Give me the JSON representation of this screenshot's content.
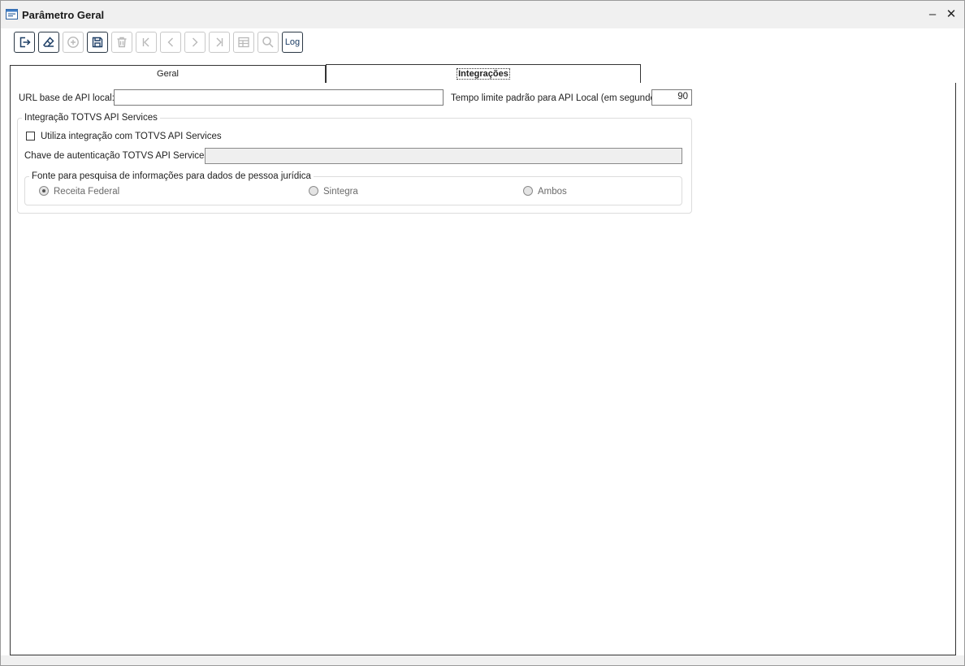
{
  "window": {
    "title": "Parâmetro Geral",
    "minimize_glyph": "–",
    "close_glyph": "✕"
  },
  "toolbar": {
    "buttons": [
      {
        "icon": "exit-icon",
        "enabled": true
      },
      {
        "icon": "eraser-icon",
        "enabled": true
      },
      {
        "icon": "add-circle-icon",
        "enabled": false
      },
      {
        "icon": "save-icon",
        "enabled": true
      },
      {
        "icon": "trash-icon",
        "enabled": false
      },
      {
        "icon": "first-record-icon",
        "enabled": false
      },
      {
        "icon": "previous-record-icon",
        "enabled": false
      },
      {
        "icon": "next-record-icon",
        "enabled": false
      },
      {
        "icon": "last-record-icon",
        "enabled": false
      },
      {
        "icon": "table-icon",
        "enabled": false
      },
      {
        "icon": "search-icon",
        "enabled": false
      }
    ],
    "log_label": "Log"
  },
  "tabs": [
    {
      "label": "Geral",
      "active": false
    },
    {
      "label": "Integrações",
      "active": true
    }
  ],
  "form": {
    "url_label": "URL base de API local:",
    "url_value": "",
    "timeout_label": "Tempo limite padrão para API Local (em segundos):",
    "timeout_value": "90",
    "group_title": "Integração TOTVS API Services",
    "use_integration_label": "Utiliza integração com TOTVS API Services",
    "use_integration_checked": false,
    "auth_key_label": "Chave de autenticação TOTVS API Services:",
    "auth_key_value": "",
    "source_group_title": "Fonte para pesquisa de informações para dados de pessoa jurídica",
    "source_options": [
      {
        "label": "Receita Federal",
        "checked": true
      },
      {
        "label": "Sintegra",
        "checked": false
      },
      {
        "label": "Ambos",
        "checked": false
      }
    ]
  },
  "colors": {
    "enabled_border": "#2b3845",
    "disabled_icon": "#b8b8b8",
    "enabled_icon": "#1e3f66"
  }
}
